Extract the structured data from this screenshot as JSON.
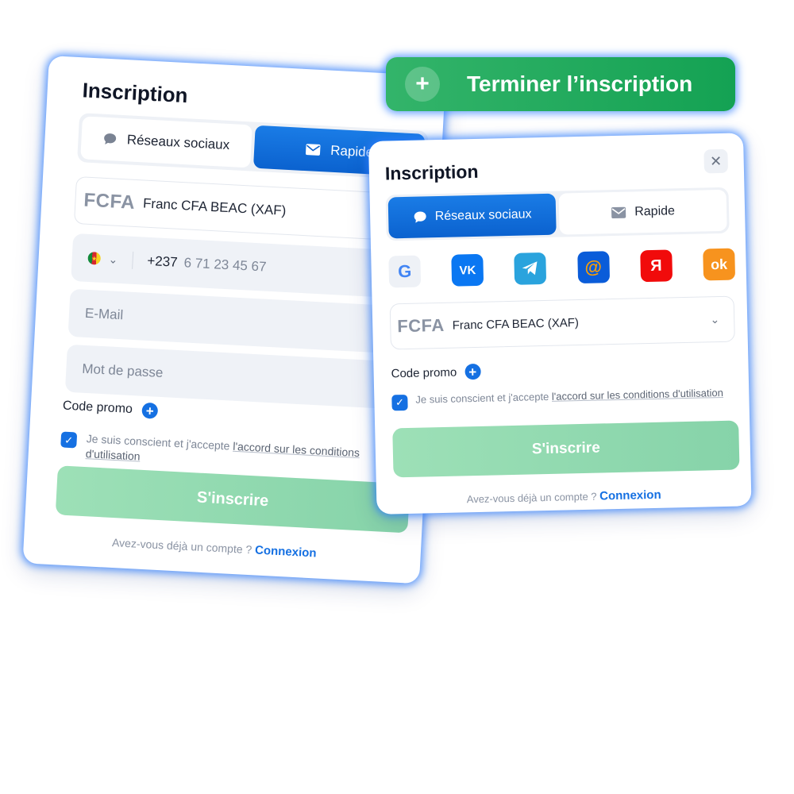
{
  "back_form": {
    "title": "Inscription",
    "tab_social": "Réseaux sociaux",
    "tab_quick": "Rapide",
    "currency_code": "FCFA",
    "currency_name": "Franc CFA BEAC (XAF)",
    "phone_code": "+237",
    "phone_placeholder": "6 71 23 45 67",
    "email_placeholder": "E-Mail",
    "password_placeholder": "Mot de passe",
    "promo_label": "Code promo",
    "agree_text": "Je suis conscient et j'accepte ",
    "agree_link": "l'accord sur les conditions d'utilisation",
    "submit": "S'inscrire",
    "login_text": "Avez-vous déjà un compte ? ",
    "login_link": "Connexion"
  },
  "banner": {
    "label": "Terminer l’inscription"
  },
  "front_form": {
    "title": "Inscription",
    "close_glyph": "✕",
    "tab_social": "Réseaux sociaux",
    "tab_quick": "Rapide",
    "currency_code": "FCFA",
    "currency_name": "Franc CFA BEAC (XAF)",
    "promo_label": "Code promo",
    "agree_text": "Je suis conscient et j'accepte ",
    "agree_link": "l'accord sur les conditions d'utilisation",
    "submit": "S'inscrire",
    "login_text": "Avez-vous déjà un compte ? ",
    "login_link": "Connexion"
  },
  "social_icons": [
    "google-icon",
    "vk-icon",
    "telegram-icon",
    "mail-ru-icon",
    "yandex-icon",
    "odnoklassniki-icon"
  ],
  "colors": {
    "accent_blue": "#1570e2",
    "banner_green": "#14a253",
    "submit_green": "#86d3a9",
    "glow": "#2d7dff"
  }
}
